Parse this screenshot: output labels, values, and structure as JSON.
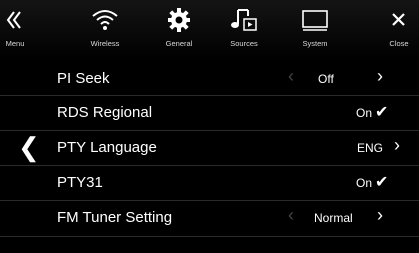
{
  "toolbar": {
    "menu": "Menu",
    "wireless": "Wireless",
    "general": "General",
    "sources": "Sources",
    "system": "System",
    "close": "Close"
  },
  "settings": [
    {
      "name": "PI Seek",
      "value": "Off",
      "control": "selector"
    },
    {
      "name": "RDS Regional",
      "value": "On",
      "control": "toggle"
    },
    {
      "name": "PTY Language",
      "value": "ENG",
      "control": "submenu"
    },
    {
      "name": "PTY31",
      "value": "On",
      "control": "toggle"
    },
    {
      "name": "FM Tuner Setting",
      "value": "Normal",
      "control": "selector"
    }
  ],
  "icons": {
    "menu": "double-chevron-left-icon",
    "wireless": "wifi-icon",
    "general": "gear-icon",
    "sources": "music-note-icon",
    "system": "monitor-icon",
    "close": "close-icon",
    "back": "chevron-left-icon"
  },
  "colors": {
    "background": "#000000",
    "text": "#ffffff",
    "disabled_arrow": "#444444"
  }
}
